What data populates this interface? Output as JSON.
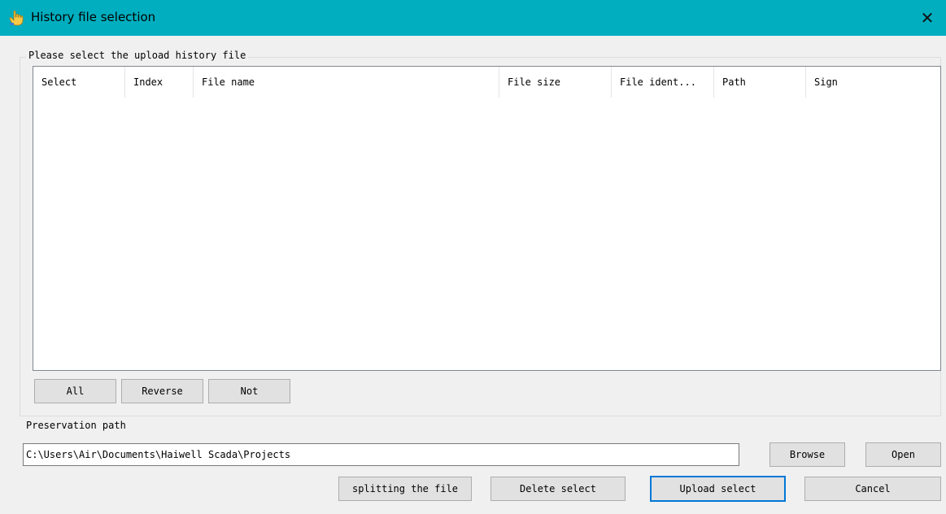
{
  "window": {
    "title": "History file selection",
    "close_glyph": "✕",
    "titlebar_color": "#00aebf"
  },
  "group": {
    "legend": "Please select the upload history file"
  },
  "table": {
    "columns": [
      "Select",
      "Index",
      "File name",
      "File size",
      "File ident...",
      "Path",
      "Sign"
    ],
    "rows": []
  },
  "selection_buttons": {
    "all": "All",
    "reverse": "Reverse",
    "not": "Not"
  },
  "preservation": {
    "label": "Preservation path",
    "path_value": "C:\\Users\\Air\\Documents\\Haiwell Scada\\Projects",
    "browse": "Browse",
    "open": "Open"
  },
  "actions": {
    "split": "splitting the file",
    "delete": "Delete select",
    "upload": "Upload select",
    "cancel": "Cancel"
  }
}
